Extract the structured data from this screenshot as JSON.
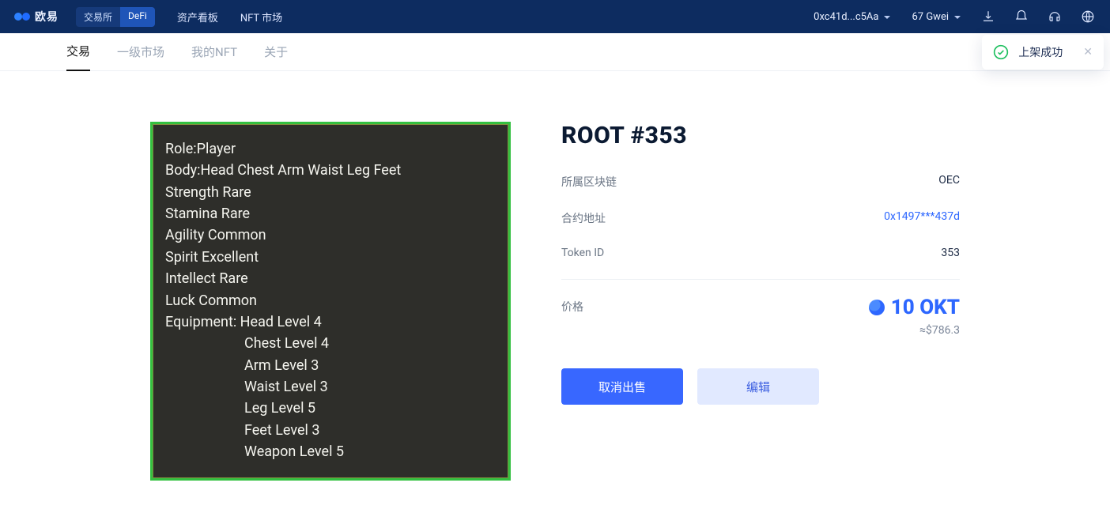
{
  "brand": "欧易",
  "segments": {
    "exchange": "交易所",
    "defi": "DeFi"
  },
  "topnav": {
    "assets": "资产看板",
    "nft_market": "NFT 市场"
  },
  "wallet": {
    "address": "0xc41d...c5Aa",
    "gas": "67 Gwei"
  },
  "subtabs": {
    "trade": "交易",
    "primary": "一级市场",
    "my_nft": "我的NFT",
    "about": "关于"
  },
  "nft": {
    "lines": [
      "Role:Player",
      "Body:Head Chest Arm Waist Leg Feet",
      "Strength Rare",
      "Stamina Rare",
      "Agility Common",
      "Spirit Excellent",
      "Intellect Rare",
      "Luck Common",
      "Equipment: Head Level 4"
    ],
    "indent_lines": [
      "Chest Level 4",
      "Arm Level 3",
      "Waist Level 3",
      "Leg Level 5",
      "Feet Level 3",
      "Weapon Level 5"
    ]
  },
  "detail": {
    "title": "ROOT #353",
    "chain_label": "所属区块链",
    "chain_value": "OEC",
    "contract_label": "合约地址",
    "contract_value": "0x1497***437d",
    "token_label": "Token ID",
    "token_value": "353",
    "price_label": "价格",
    "price_value": "10 OKT",
    "price_usd": "≈$786.3",
    "cancel_btn": "取消出售",
    "edit_btn": "编辑"
  },
  "toast": {
    "text": "上架成功"
  }
}
